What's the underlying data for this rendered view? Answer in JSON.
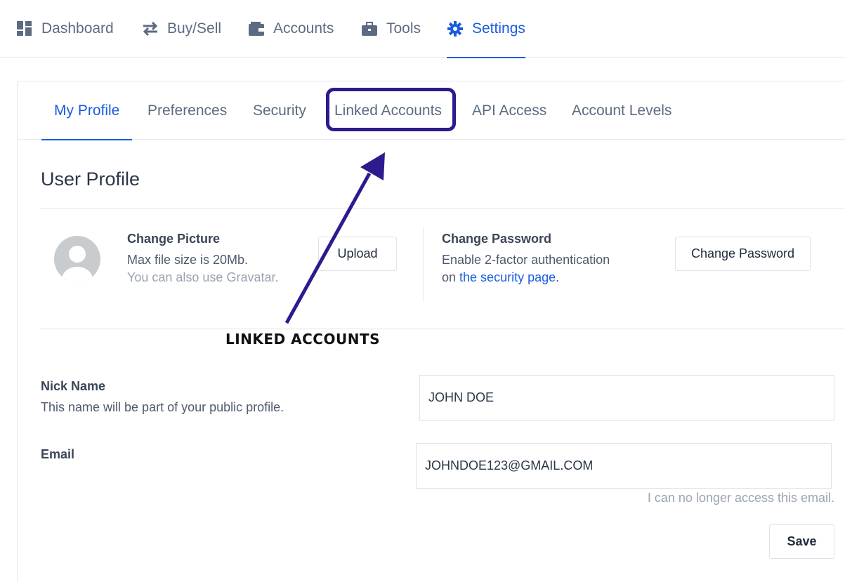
{
  "topnav": {
    "items": [
      {
        "label": "Dashboard",
        "icon": "dashboard-icon"
      },
      {
        "label": "Buy/Sell",
        "icon": "swap-arrows-icon"
      },
      {
        "label": "Accounts",
        "icon": "wallet-icon"
      },
      {
        "label": "Tools",
        "icon": "briefcase-icon"
      },
      {
        "label": "Settings",
        "icon": "gear-icon",
        "active": true
      }
    ]
  },
  "subtabs": [
    {
      "label": "My Profile",
      "active": true
    },
    {
      "label": "Preferences"
    },
    {
      "label": "Security"
    },
    {
      "label": "Linked Accounts",
      "highlighted": true
    },
    {
      "label": "API Access"
    },
    {
      "label": "Account Levels"
    }
  ],
  "profile": {
    "title": "User Profile",
    "picture": {
      "heading": "Change Picture",
      "line1": "Max file size is 20Mb.",
      "line2": "You can also use Gravatar.",
      "upload_label": "Upload"
    },
    "password": {
      "heading": "Change Password",
      "line1": "Enable 2-factor authentication",
      "line2_prefix": "on ",
      "line2_link": "the security page",
      "line2_suffix": ".",
      "button_label": "Change Password"
    },
    "nickname": {
      "label": "Nick Name",
      "help": "This name will be part of your public profile.",
      "value": "JOHN DOE"
    },
    "email": {
      "label": "Email",
      "value": "JOHNDOE123@GMAIL.COM",
      "help": "I can no longer access this email."
    },
    "save_label": "Save"
  },
  "annotation": {
    "label": "LINKED ACCOUNTS",
    "color": "#2d1a8e"
  },
  "colors": {
    "accent": "#1a5ce0",
    "annotation": "#2d1a8e"
  }
}
